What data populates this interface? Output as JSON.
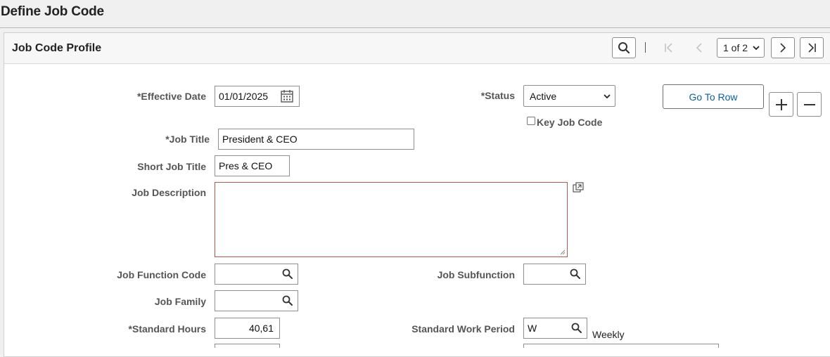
{
  "page": {
    "title": "Define Job Code"
  },
  "panel": {
    "title": "Job Code Profile",
    "pager": {
      "current": "1 of 2"
    }
  },
  "form": {
    "effective_date": {
      "label": "*Effective Date",
      "value": "01/01/2025"
    },
    "status": {
      "label": "*Status",
      "value": "Active"
    },
    "go_to_row": "Go To Row",
    "key_job_code": {
      "label": "Key Job Code",
      "checked": false
    },
    "job_title": {
      "label": "*Job Title",
      "value": "President & CEO"
    },
    "short_job_title": {
      "label": "Short Job Title",
      "value": "Pres & CEO"
    },
    "job_description": {
      "label": "Job Description",
      "value": ""
    },
    "job_function_code": {
      "label": "Job Function Code",
      "value": ""
    },
    "job_subfunction": {
      "label": "Job Subfunction",
      "value": ""
    },
    "job_family": {
      "label": "Job Family",
      "value": ""
    },
    "standard_hours": {
      "label": "*Standard Hours",
      "value": "40,61"
    },
    "standard_work_period": {
      "label": "Standard Work Period",
      "value": "W",
      "description": "Weekly"
    }
  },
  "icons": {
    "search": "search-icon",
    "first": "first-page-icon",
    "prev": "previous-icon",
    "next": "next-icon",
    "last": "last-page-icon",
    "calendar": "calendar-icon",
    "expand": "expand-textarea-icon",
    "add": "plus-icon",
    "delete": "minus-icon"
  },
  "colors": {
    "link": "#0a5fa6",
    "textarea_border": "#b35a4e"
  }
}
